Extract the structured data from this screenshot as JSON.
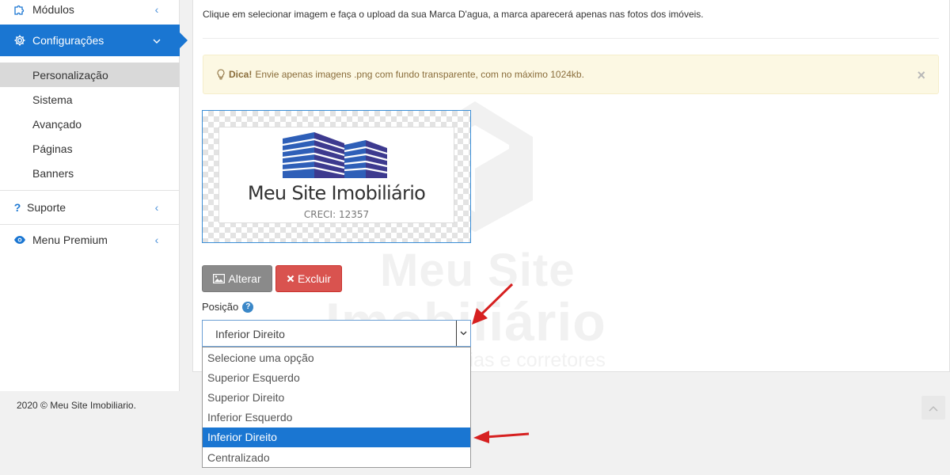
{
  "sidebar": {
    "modulos": "Módulos",
    "configuracoes": "Configurações",
    "sub_items": [
      "Personalização",
      "Sistema",
      "Avançado",
      "Páginas",
      "Banners"
    ],
    "suporte": "Suporte",
    "premium": "Menu Premium"
  },
  "footer": {
    "copyright": "2020 © Meu Site Imobiliario."
  },
  "main": {
    "intro": "Clique em selecionar imagem e faça o upload da sua Marca D'agua, a marca aparecerá apenas nas fotos dos imóveis.",
    "alert": {
      "title": "Dica!",
      "text": "Envie apenas imagens .png com fundo transparente, com no máximo 1024kb.",
      "close": "×"
    },
    "watermark": {
      "line1": "Meu Site",
      "line2": "Imobiliário",
      "line3": "Site para mobiliarias e corretores"
    },
    "logo": {
      "name": "Meu Site Imobiliário",
      "creci": "CRECI: 12357"
    },
    "buttons": {
      "alterar": "Alterar",
      "excluir": "Excluir"
    },
    "position_label": "Posição",
    "help": "?",
    "select": {
      "value": "Inferior Direito",
      "options": [
        "Selecione uma opção",
        "Superior Esquerdo",
        "Superior Direito",
        "Inferior Esquerdo",
        "Inferior Direito",
        "Centralizado"
      ],
      "selected_index": 4
    }
  },
  "colors": {
    "accent": "#1a76d2",
    "danger": "#d9534f",
    "warning_bg": "#fcf8e3",
    "arrow": "#d62020"
  }
}
